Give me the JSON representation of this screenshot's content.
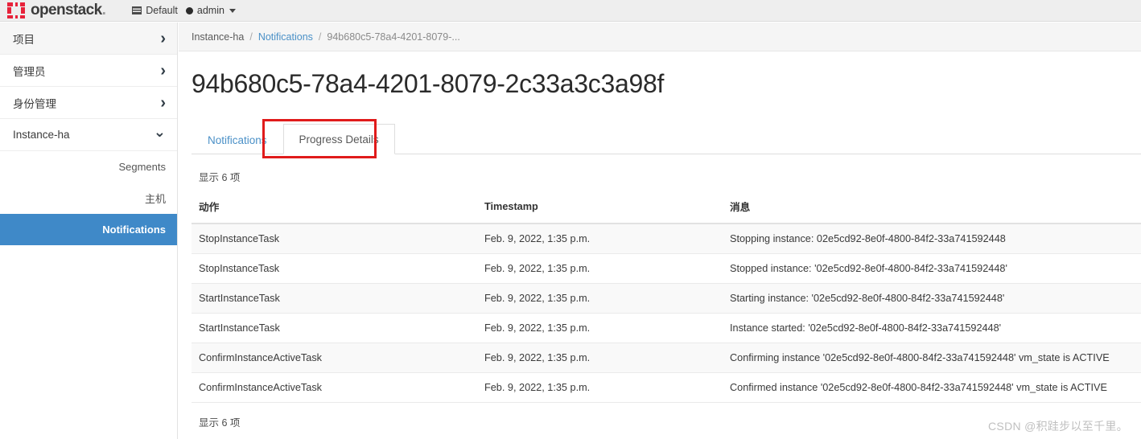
{
  "topbar": {
    "brand_name": "openstack",
    "brand_suffix": ".",
    "domain_icon": "list-icon",
    "domain_label": "Default",
    "user_icon": "user-dot-icon",
    "user_label": "admin",
    "caret_icon": "caret-down-icon"
  },
  "sidebar": {
    "groups": [
      {
        "label": "项目",
        "icon": "chevron-right-icon",
        "expanded": false,
        "shaded": true
      },
      {
        "label": "管理员",
        "icon": "chevron-right-icon",
        "expanded": false,
        "shaded": false
      },
      {
        "label": "身份管理",
        "icon": "chevron-right-icon",
        "expanded": false,
        "shaded": false
      },
      {
        "label": "Instance-ha",
        "icon": "chevron-down-icon",
        "expanded": true,
        "shaded": false
      }
    ],
    "sub_items": [
      {
        "label": "Segments",
        "active": false
      },
      {
        "label": "主机",
        "active": false
      },
      {
        "label": "Notifications",
        "active": true
      }
    ]
  },
  "breadcrumb": {
    "items": [
      {
        "label": "Instance-ha",
        "type": "text"
      },
      {
        "label": "Notifications",
        "type": "link"
      },
      {
        "label": "94b680c5-78a4-4201-8079-...",
        "type": "current"
      }
    ],
    "separator": "/"
  },
  "page": {
    "title": "94b680c5-78a4-4201-8079-2c33a3c3a98f"
  },
  "tabs": [
    {
      "label": "Notifications",
      "active": false
    },
    {
      "label": "Progress Details",
      "active": true
    }
  ],
  "table": {
    "count_top": "显示 6 项",
    "count_bottom": "显示 6 项",
    "headers": [
      "动作",
      "Timestamp",
      "消息"
    ],
    "rows": [
      {
        "action": "StopInstanceTask",
        "timestamp": "Feb. 9, 2022, 1:35 p.m.",
        "message": "Stopping instance: 02e5cd92-8e0f-4800-84f2-33a741592448"
      },
      {
        "action": "StopInstanceTask",
        "timestamp": "Feb. 9, 2022, 1:35 p.m.",
        "message": "Stopped instance: '02e5cd92-8e0f-4800-84f2-33a741592448'"
      },
      {
        "action": "StartInstanceTask",
        "timestamp": "Feb. 9, 2022, 1:35 p.m.",
        "message": "Starting instance: '02e5cd92-8e0f-4800-84f2-33a741592448'"
      },
      {
        "action": "StartInstanceTask",
        "timestamp": "Feb. 9, 2022, 1:35 p.m.",
        "message": "Instance started: '02e5cd92-8e0f-4800-84f2-33a741592448'"
      },
      {
        "action": "ConfirmInstanceActiveTask",
        "timestamp": "Feb. 9, 2022, 1:35 p.m.",
        "message": "Confirming instance '02e5cd92-8e0f-4800-84f2-33a741592448' vm_state is ACTIVE"
      },
      {
        "action": "ConfirmInstanceActiveTask",
        "timestamp": "Feb. 9, 2022, 1:35 p.m.",
        "message": "Confirmed instance '02e5cd92-8e0f-4800-84f2-33a741592448' vm_state is ACTIVE"
      }
    ]
  },
  "annotation": {
    "color": "#e01b1b",
    "target": "Progress Details"
  },
  "watermark": {
    "text": "CSDN @积跬步以至千里。"
  },
  "colors": {
    "accent_blue": "#3f89c8",
    "link_blue": "#4a90c7",
    "brand_red": "#e7223a",
    "annotation_red": "#e01b1b"
  }
}
